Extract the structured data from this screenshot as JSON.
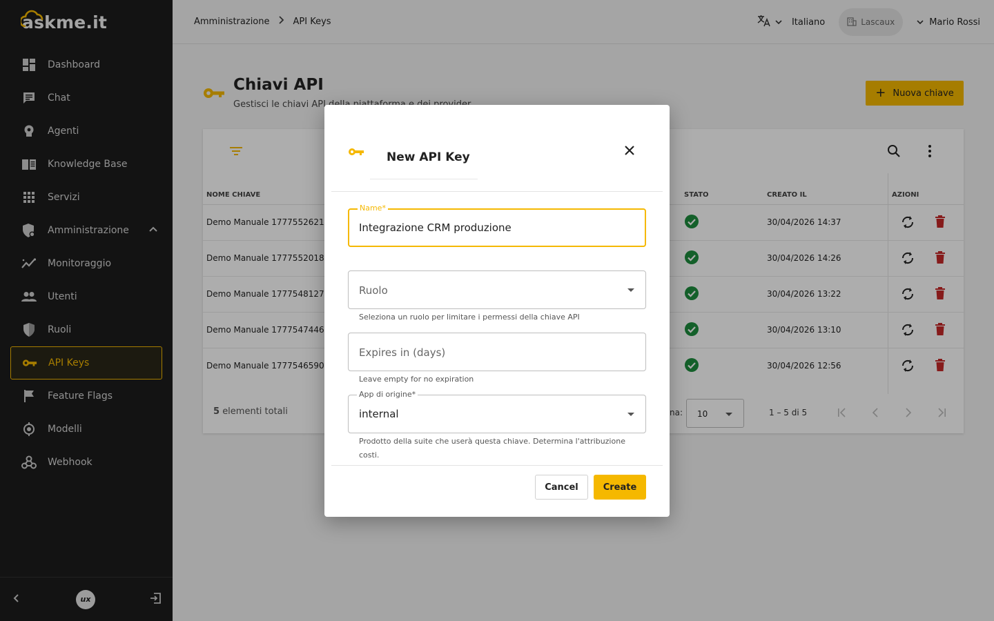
{
  "brand": {
    "logo_text": "askme.it",
    "accent": "#f5b800",
    "sidebar_bg": "#1c1c1c"
  },
  "sidebar": {
    "items": [
      {
        "label": "Dashboard",
        "icon": "dashboard-icon"
      },
      {
        "label": "Chat",
        "icon": "chat-icon"
      },
      {
        "label": "Agenti",
        "icon": "agent-icon"
      },
      {
        "label": "Knowledge Base",
        "icon": "book-icon"
      },
      {
        "label": "Servizi",
        "icon": "grid-icon"
      },
      {
        "label": "Amministrazione",
        "icon": "admin-shield-icon"
      },
      {
        "label": "Monitoraggio",
        "icon": "monitoring-icon"
      },
      {
        "label": "Utenti",
        "icon": "users-icon"
      },
      {
        "label": "Ruoli",
        "icon": "shield-icon"
      },
      {
        "label": "API Keys",
        "icon": "key-icon"
      },
      {
        "label": "Feature Flags",
        "icon": "flag-icon"
      },
      {
        "label": "Modelli",
        "icon": "model-icon"
      },
      {
        "label": "Webhook",
        "icon": "webhook-icon"
      }
    ],
    "active": "API Keys",
    "footer_badge": "ux"
  },
  "header": {
    "breadcrumb": [
      "Amministrazione",
      "API Keys"
    ],
    "language": "Italiano",
    "organization": "Lascaux",
    "user": "Mario Rossi"
  },
  "page": {
    "title": "Chiavi API",
    "subtitle": "Gestisci le chiavi API della piattaforma e dei provider",
    "new_button": "Nuova chiave"
  },
  "table": {
    "columns": {
      "name": "NOME CHIAVE",
      "status": "STATO",
      "created": "CREATO IL",
      "actions": "AZIONI"
    },
    "rows": [
      {
        "name": "Demo Manuale 1777552621",
        "created": "30/04/2026 14:37"
      },
      {
        "name": "Demo Manuale 1777552018",
        "created": "30/04/2026 14:26"
      },
      {
        "name": "Demo Manuale 1777548127",
        "created": "30/04/2026 13:22"
      },
      {
        "name": "Demo Manuale 1777547446",
        "created": "30/04/2026 13:10"
      },
      {
        "name": "Demo Manuale 1777546590",
        "created": "30/04/2026 12:56"
      }
    ],
    "total_count": "5",
    "total_label": "elementi totali",
    "per_page_label": "na:",
    "per_page": "10",
    "range": "1 – 5 di 5"
  },
  "dialog": {
    "title": "New API Key",
    "name_label": "Name*",
    "name_value": "Integrazione CRM produzione",
    "role_placeholder": "Ruolo",
    "role_hint": "Seleziona un ruolo per limitare i permessi della chiave API",
    "expires_placeholder": "Expires in (days)",
    "expires_hint": "Leave empty for no expiration",
    "app_label": "App di origine*",
    "app_value": "internal",
    "app_hint": "Prodotto della suite che userà questa chiave. Determina l'attribuzione costi.",
    "cancel": "Cancel",
    "create": "Create"
  }
}
